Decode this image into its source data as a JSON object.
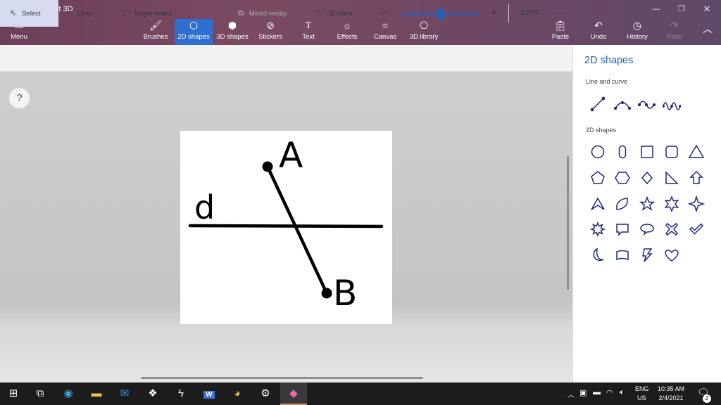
{
  "window": {
    "title": "Untitled* - Paint 3D"
  },
  "ribbon": {
    "menu_label": "Menu",
    "tools": [
      {
        "label": "Brushes",
        "icon": "brush-icon"
      },
      {
        "label": "2D shapes",
        "icon": "2d-shapes-icon",
        "active": true
      },
      {
        "label": "3D shapes",
        "icon": "3d-shapes-icon"
      },
      {
        "label": "Stickers",
        "icon": "stickers-icon"
      },
      {
        "label": "Text",
        "icon": "text-icon"
      },
      {
        "label": "Effects",
        "icon": "effects-icon"
      },
      {
        "label": "Canvas",
        "icon": "canvas-icon"
      },
      {
        "label": "3D library",
        "icon": "3d-library-icon"
      }
    ],
    "paste_label": "Paste",
    "undo_label": "Undo",
    "history_label": "History",
    "redo_label": "Redo"
  },
  "command_bar": {
    "select_label": "Select",
    "crop_label": "Crop",
    "magic_select_label": "Magic select",
    "mixed_reality_label": "Mixed reality",
    "view_3d_label": "3D view",
    "zoom_minus": "—",
    "zoom_plus": "+",
    "zoom_level": "100%",
    "zoom_fraction": 0.5,
    "more": "···"
  },
  "help_label": "?",
  "canvas_drawing": {
    "label_a": "A",
    "label_b": "B",
    "label_d": "d"
  },
  "side_panel": {
    "title": "2D shapes",
    "line_section": "Line and curve",
    "shapes_section": "2D shapes"
  },
  "taskbar": {
    "language": "ENG",
    "region": "US",
    "time": "10:35 AM",
    "date": "2/4/2021",
    "notifications": "2"
  },
  "colors": {
    "accent": "#2f6fd0",
    "ribbon": "#6e3f5a",
    "panel_icon": "#1e2a78"
  }
}
